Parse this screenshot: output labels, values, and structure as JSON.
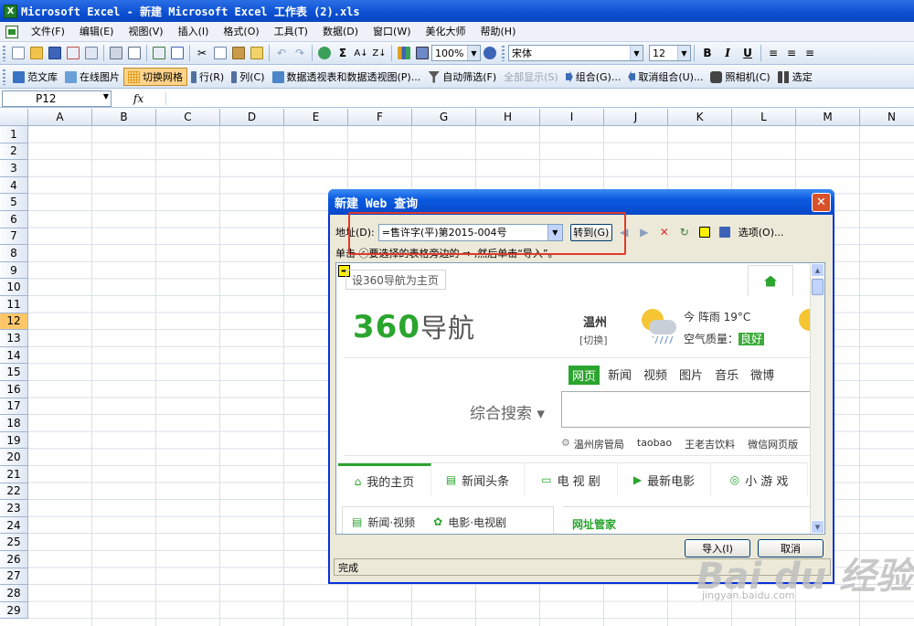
{
  "window": {
    "title": "Microsoft Excel - 新建 Microsoft Excel 工作表 (2).xls",
    "app_letter": "X"
  },
  "menu": [
    "文件(F)",
    "编辑(E)",
    "视图(V)",
    "插入(I)",
    "格式(O)",
    "工具(T)",
    "数据(D)",
    "窗口(W)",
    "美化大师",
    "帮助(H)"
  ],
  "toolbar1": {
    "zoom": "100%",
    "font": "宋体",
    "font_size": "12",
    "bold": "B",
    "italic": "I",
    "underline": "U"
  },
  "toolbar2": {
    "items": [
      {
        "label": "范文库",
        "state": "normal",
        "color": "#3a72c4"
      },
      {
        "label": "在线图片",
        "state": "normal",
        "color": "#6aa0d8"
      },
      {
        "label": "切换网格",
        "state": "active",
        "color": "#e0a020"
      },
      {
        "label": "行(R)",
        "state": "normal",
        "color": "#5070a0"
      },
      {
        "label": "列(C)",
        "state": "normal",
        "color": "#5070a0"
      },
      {
        "label": "数据透视表和数据透视图(P)...",
        "state": "normal",
        "color": "#4c86c8"
      },
      {
        "label": "自动筛选(F)",
        "state": "normal",
        "color": "#5a5a5a"
      },
      {
        "label": "全部显示(S)",
        "state": "disabled",
        "color": "#b0b8c4"
      },
      {
        "label": "组合(G)...",
        "state": "normal",
        "color": "#3c6cb4"
      },
      {
        "label": "取消组合(U)...",
        "state": "normal",
        "color": "#3c6cb4"
      },
      {
        "label": "照相机(C)",
        "state": "normal",
        "color": "#444"
      },
      {
        "label": "选定",
        "state": "normal",
        "color": "#444"
      }
    ]
  },
  "formula_bar": {
    "name_box": "P12",
    "fx": "fx",
    "formula": ""
  },
  "grid": {
    "columns": [
      "A",
      "B",
      "C",
      "D",
      "E",
      "F",
      "G",
      "H",
      "I",
      "J",
      "K",
      "L",
      "M",
      "N"
    ],
    "rows": [
      "1",
      "2",
      "3",
      "4",
      "5",
      "6",
      "7",
      "8",
      "9",
      "10",
      "11",
      "12",
      "13",
      "14",
      "15",
      "16",
      "17",
      "18",
      "19",
      "20",
      "21",
      "22",
      "23",
      "24",
      "25",
      "26",
      "27",
      "28",
      "29"
    ],
    "selected_row": "12"
  },
  "dialog": {
    "title": "新建 Web 查询",
    "close": "✕",
    "address_label": "地址(D):",
    "address_value": "=售许字(平)第2015-004号",
    "goto_label": "转到(G)",
    "options_label": "选项(O)...",
    "hint": "单击 ⓒ要选择的表格旁边的 ➡ ,然后单击“导入”。",
    "import_label": "导入(I)",
    "cancel_label": "取消",
    "status": "完成"
  },
  "webpage": {
    "set_home": "设360导航为主页",
    "logo_num": "360",
    "logo_text": "导航",
    "city": "温州",
    "city_switch": "[切换]",
    "weather": "今 阵雨  19°C",
    "air_label": "空气质量：",
    "air_value": "良好",
    "search_tabs": [
      "网页",
      "新闻",
      "视频",
      "图片",
      "音乐",
      "微博"
    ],
    "search_label": "综合搜索 ▾",
    "hotwords": [
      "温州房管局",
      "taobao",
      "王老吉饮料",
      "微信网页版"
    ],
    "bottom_tabs": [
      "我的主页",
      "新闻头条",
      "电 视 剧",
      "最新电影",
      "小 游 戏"
    ],
    "card_items": [
      "新闻·视频",
      "电影·电视剧"
    ],
    "card2": "网址管家"
  },
  "watermark": {
    "main": "Bai du 经验",
    "sub": "jingyan.baidu.com"
  }
}
